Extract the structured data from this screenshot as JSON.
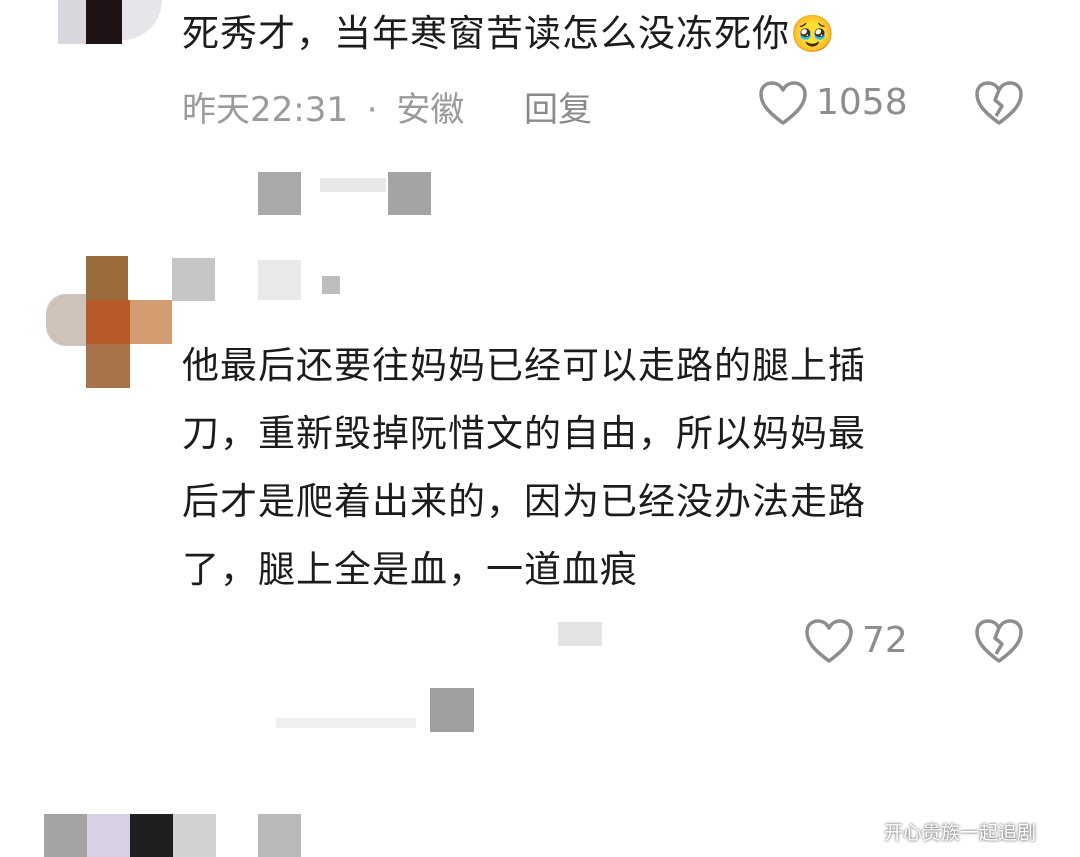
{
  "comments": [
    {
      "text": "死秀才，当年寒窗苦读怎么没冻死你",
      "emoji": "🥹",
      "time": "昨天22:31",
      "location": "安徽",
      "separator": "·",
      "reply_label": "回复",
      "likes": "1058"
    },
    {
      "lines": [
        "他最后还要往妈妈已经可以走路的腿上插",
        "刀，重新毁掉阮惜文的自由，所以妈妈最",
        "后才是爬着出来的，因为已经没办法走路",
        "了，腿上全是血，一道血痕"
      ],
      "likes": "72"
    }
  ],
  "watermark": "开心贵族一起追剧",
  "colors": {
    "text": "#1c1c1c",
    "muted": "#9a9a9a",
    "icon": "#8d8d8d"
  },
  "icons": [
    "heart-outline-icon",
    "broken-heart-icon"
  ]
}
